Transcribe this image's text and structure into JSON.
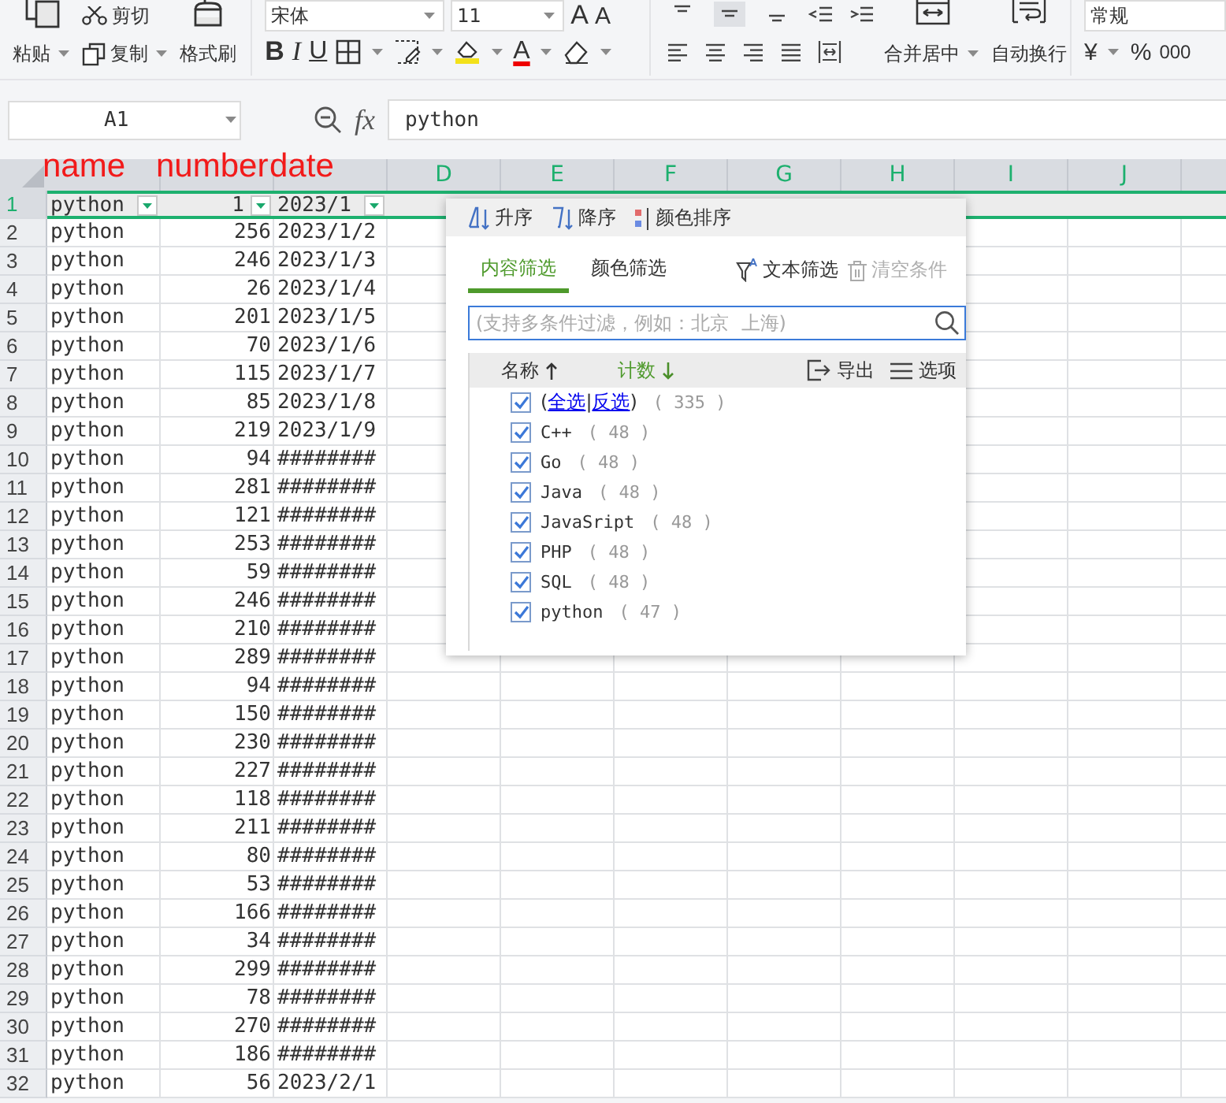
{
  "ribbon": {
    "clipboard": {
      "paste": "粘贴",
      "cut": "剪切",
      "copy": "复制",
      "format_painter": "格式刷"
    },
    "font": {
      "name": "宋体",
      "size": "11",
      "grow": "A",
      "shrink": "A",
      "bold": "B",
      "italic": "I",
      "underline": "U",
      "color_letter": "A"
    },
    "vertical_align": [
      {
        "selected": false
      },
      {
        "selected": true
      },
      {
        "selected": false
      }
    ],
    "alignment": {
      "merge": "合并居中",
      "wrap": "自动换行"
    },
    "number": {
      "format": "常规",
      "currency": "¥",
      "percent": "%",
      "thousands": "000"
    }
  },
  "formula_bar": {
    "cell_ref": "A1",
    "fx": "fx",
    "value": "python"
  },
  "annotations": [
    "name",
    "number",
    "date"
  ],
  "columns": [
    "D",
    "E",
    "F",
    "G",
    "H",
    "I",
    "J"
  ],
  "rows": [
    {
      "num": "1",
      "cells": [
        "python",
        "1",
        "2023/1"
      ],
      "selected": true,
      "filter": true
    },
    {
      "num": "2",
      "cells": [
        "python",
        "256",
        "2023/1/2"
      ],
      "selected": false
    },
    {
      "num": "3",
      "cells": [
        "python",
        "246",
        "2023/1/3"
      ],
      "selected": false
    },
    {
      "num": "4",
      "cells": [
        "python",
        "26",
        "2023/1/4"
      ],
      "selected": false
    },
    {
      "num": "5",
      "cells": [
        "python",
        "201",
        "2023/1/5"
      ],
      "selected": false
    },
    {
      "num": "6",
      "cells": [
        "python",
        "70",
        "2023/1/6"
      ],
      "selected": false
    },
    {
      "num": "7",
      "cells": [
        "python",
        "115",
        "2023/1/7"
      ],
      "selected": false
    },
    {
      "num": "8",
      "cells": [
        "python",
        "85",
        "2023/1/8"
      ],
      "selected": false
    },
    {
      "num": "9",
      "cells": [
        "python",
        "219",
        "2023/1/9"
      ],
      "selected": false
    },
    {
      "num": "10",
      "cells": [
        "python",
        "94",
        "########"
      ],
      "selected": false
    },
    {
      "num": "11",
      "cells": [
        "python",
        "281",
        "########"
      ],
      "selected": false
    },
    {
      "num": "12",
      "cells": [
        "python",
        "121",
        "########"
      ],
      "selected": false
    },
    {
      "num": "13",
      "cells": [
        "python",
        "253",
        "########"
      ],
      "selected": false
    },
    {
      "num": "14",
      "cells": [
        "python",
        "59",
        "########"
      ],
      "selected": false
    },
    {
      "num": "15",
      "cells": [
        "python",
        "246",
        "########"
      ],
      "selected": false
    },
    {
      "num": "16",
      "cells": [
        "python",
        "210",
        "########"
      ],
      "selected": false
    },
    {
      "num": "17",
      "cells": [
        "python",
        "289",
        "########"
      ],
      "selected": false
    },
    {
      "num": "18",
      "cells": [
        "python",
        "94",
        "########"
      ],
      "selected": false
    },
    {
      "num": "19",
      "cells": [
        "python",
        "150",
        "########"
      ],
      "selected": false
    },
    {
      "num": "20",
      "cells": [
        "python",
        "230",
        "########"
      ],
      "selected": false
    },
    {
      "num": "21",
      "cells": [
        "python",
        "227",
        "########"
      ],
      "selected": false
    },
    {
      "num": "22",
      "cells": [
        "python",
        "118",
        "########"
      ],
      "selected": false
    },
    {
      "num": "23",
      "cells": [
        "python",
        "211",
        "########"
      ],
      "selected": false
    },
    {
      "num": "24",
      "cells": [
        "python",
        "80",
        "########"
      ],
      "selected": false
    },
    {
      "num": "25",
      "cells": [
        "python",
        "53",
        "########"
      ],
      "selected": false
    },
    {
      "num": "26",
      "cells": [
        "python",
        "166",
        "########"
      ],
      "selected": false
    },
    {
      "num": "27",
      "cells": [
        "python",
        "34",
        "########"
      ],
      "selected": false
    },
    {
      "num": "28",
      "cells": [
        "python",
        "299",
        "########"
      ],
      "selected": false
    },
    {
      "num": "29",
      "cells": [
        "python",
        "78",
        "########"
      ],
      "selected": false
    },
    {
      "num": "30",
      "cells": [
        "python",
        "270",
        "########"
      ],
      "selected": false
    },
    {
      "num": "31",
      "cells": [
        "python",
        "186",
        "########"
      ],
      "selected": false
    },
    {
      "num": "32",
      "cells": [
        "python",
        "56",
        "2023/2/1"
      ],
      "selected": false
    }
  ],
  "filter_popup": {
    "sort": [
      "升序",
      "降序",
      "颜色排序"
    ],
    "tabs": [
      {
        "label": "内容筛选",
        "selected": true
      },
      {
        "label": "颜色筛选",
        "selected": false
      }
    ],
    "text_filter": "文本筛选",
    "clear": {
      "label": "清空条件",
      "disabled": true
    },
    "search": {
      "placeholder": "(支持多条件过滤，例如：北京  上海)"
    },
    "list_header": {
      "name": "名称",
      "count": "计数",
      "export": "导出",
      "options": "选项"
    },
    "select_all": {
      "open": "(",
      "select": "全选",
      "separator": "|",
      "invert": "反选",
      "close": ")",
      "count": "( 335 )",
      "checked": true
    },
    "items": [
      {
        "label": "C++",
        "count": "( 48 )",
        "checked": true
      },
      {
        "label": "Go",
        "count": "( 48 )",
        "checked": true
      },
      {
        "label": "Java",
        "count": "( 48 )",
        "checked": true
      },
      {
        "label": "JavaSript",
        "count": "( 48 )",
        "checked": true
      },
      {
        "label": "PHP",
        "count": "( 48 )",
        "checked": true
      },
      {
        "label": "SQL",
        "count": "( 48 )",
        "checked": true
      },
      {
        "label": "python",
        "count": "( 47 )",
        "checked": true
      }
    ]
  }
}
